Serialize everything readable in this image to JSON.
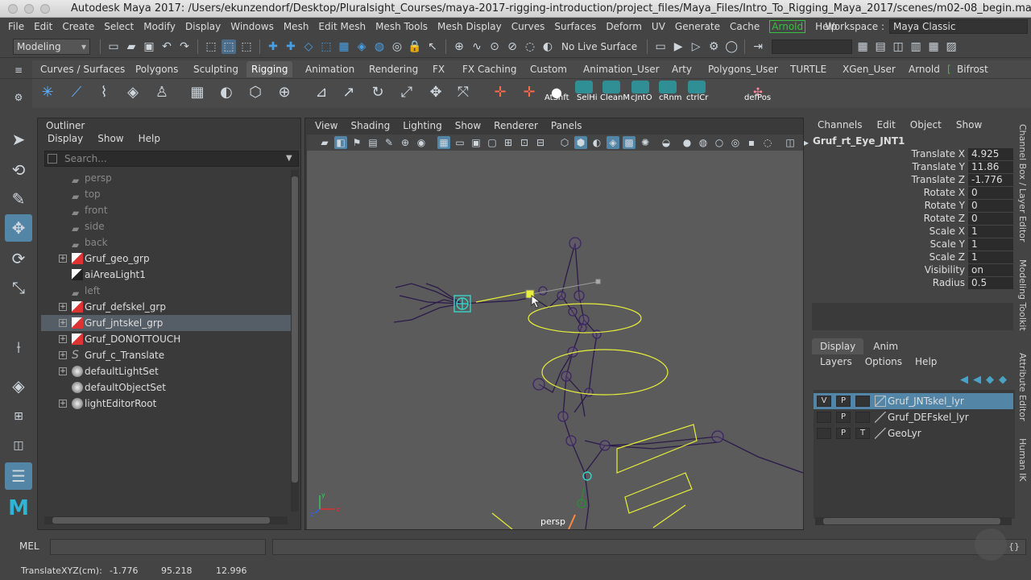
{
  "title": "Autodesk Maya 2017: /Users/ekunzendorf/Desktop/Pluralsight_Courses/maya-2017-rigging-introduction/project_files/Maya_Files/Intro_To_Rigging_Maya_2017/scenes/m02-08_begin.ma* ---...",
  "menu": [
    "File",
    "Edit",
    "Create",
    "Select",
    "Modify",
    "Display",
    "Windows",
    "Mesh",
    "Edit Mesh",
    "Mesh Tools",
    "Mesh Display",
    "Curves",
    "Surfaces",
    "Deform",
    "UV",
    "Generate",
    "Cache"
  ],
  "menu_arnold": "Arnold",
  "menu_help": "Help",
  "workspace_label": "Workspace :",
  "workspace_value": "Maya Classic",
  "mode": "Modeling",
  "no_live_surface": "No Live Surface",
  "shelf_tabs": [
    "Curves / Surfaces",
    "Polygons",
    "Sculpting",
    "Rigging",
    "Animation",
    "Rendering",
    "FX",
    "FX Caching",
    "Custom",
    "Animation_User",
    "Arty",
    "Polygons_User",
    "TURTLE",
    "XGen_User",
    "Arnold",
    "Bifrost"
  ],
  "shelf_labels": [
    "AtShft",
    "SelHi",
    "CleanM",
    "cJntO",
    "cRnm",
    "ctrlCr",
    "defPos"
  ],
  "outliner": {
    "title": "Outliner",
    "menu": [
      "Display",
      "Show",
      "Help"
    ],
    "search_placeholder": "Search...",
    "items": [
      "persp",
      "top",
      "front",
      "side",
      "back",
      "Gruf_geo_grp",
      "aiAreaLight1",
      "left",
      "Gruf_defskel_grp",
      "Gruf_jntskel_grp",
      "Gruf_DONOTTOUCH",
      "Gruf_c_Translate",
      "defaultLightSet",
      "defaultObjectSet",
      "lightEditorRoot"
    ]
  },
  "viewport": {
    "menu": [
      "View",
      "Shading",
      "Lighting",
      "Show",
      "Renderer",
      "Panels"
    ],
    "camera": "persp"
  },
  "channel_box": {
    "menu": [
      "Channels",
      "Edit",
      "Object",
      "Show"
    ],
    "object": "Gruf_rt_Eye_JNT1",
    "attrs": [
      {
        "k": "Translate X",
        "v": "4.925"
      },
      {
        "k": "Translate Y",
        "v": "11.86"
      },
      {
        "k": "Translate Z",
        "v": "-1.776"
      },
      {
        "k": "Rotate X",
        "v": "0"
      },
      {
        "k": "Rotate Y",
        "v": "0"
      },
      {
        "k": "Rotate Z",
        "v": "0"
      },
      {
        "k": "Scale X",
        "v": "1"
      },
      {
        "k": "Scale Y",
        "v": "1"
      },
      {
        "k": "Scale Z",
        "v": "1"
      },
      {
        "k": "Visibility",
        "v": "on"
      },
      {
        "k": "Radius",
        "v": "0.5"
      }
    ]
  },
  "side_tabs": [
    "Channel Box / Layer Editor",
    "Modeling Toolkit",
    "Attribute Editor",
    "Human IK"
  ],
  "layers": {
    "tabs": [
      "Display",
      "Anim"
    ],
    "menu": [
      "Layers",
      "Options",
      "Help"
    ],
    "rows": [
      {
        "v": "V",
        "p": "P",
        "t": "",
        "name": "Gruf_JNTskel_lyr"
      },
      {
        "v": "",
        "p": "P",
        "t": "",
        "name": "Gruf_DEFskel_lyr"
      },
      {
        "v": "",
        "p": "P",
        "t": "T",
        "name": "GeoLyr"
      }
    ]
  },
  "command": {
    "label": "MEL"
  },
  "help_line": {
    "label": "TranslateXYZ(cm):",
    "x": "-1.776",
    "y": "95.218",
    "z": "12.996"
  }
}
